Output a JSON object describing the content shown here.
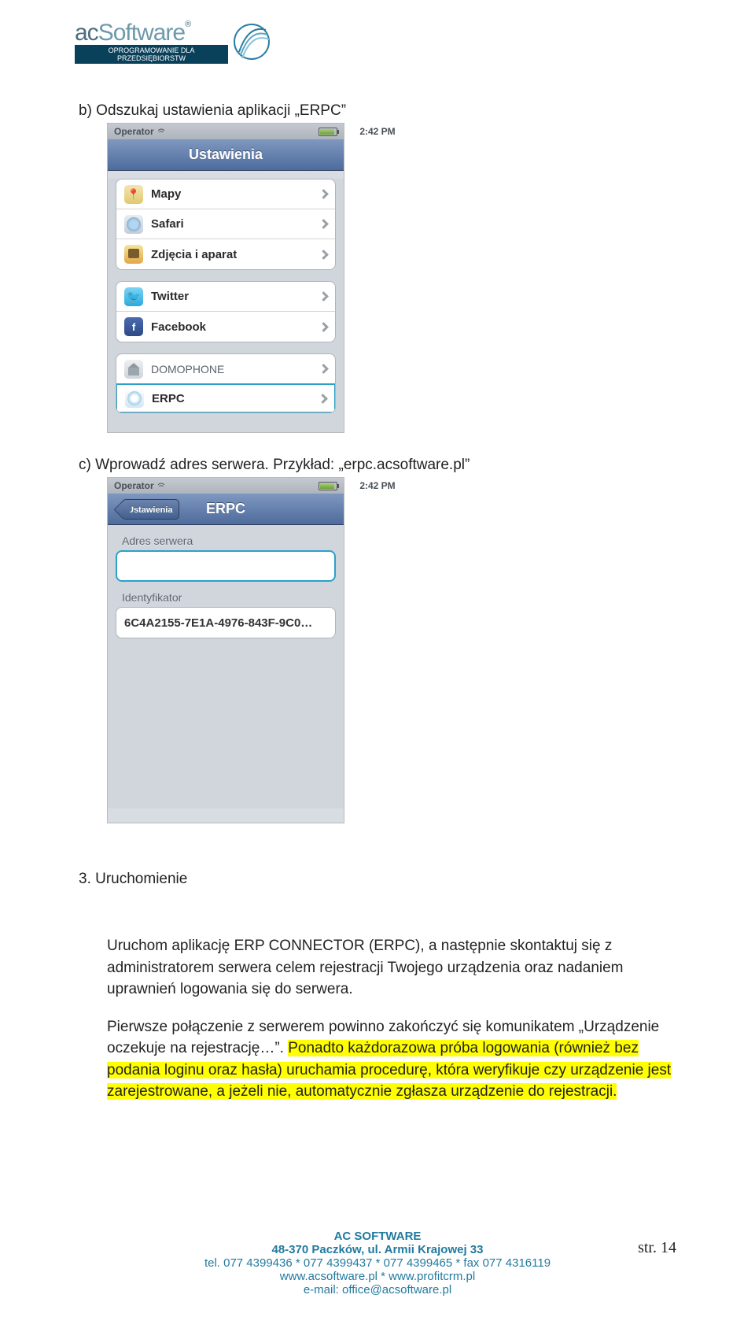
{
  "logo": {
    "name1": "ac",
    "name2": "Software",
    "reg": "®",
    "tagline": "OPROGRAMOWANIE DLA PRZEDSIĘBIORSTW"
  },
  "content": {
    "line_b": "b)  Odszukaj ustawienia aplikacji „ERPC”",
    "line_c": "c)  Wprowadź adres serwera. Przykład: „erpc.acsoftware.pl”",
    "sec3_title": "3. Uruchomienie",
    "sec3_p1": "Uruchom aplikację ERP CONNECTOR (ERPC), a następnie skontaktuj się z administratorem serwera celem rejestracji Twojego urządzenia oraz nadaniem uprawnień logowania się do serwera.",
    "sec3_p2a": "Pierwsze połączenie z serwerem powinno zakończyć się komunikatem „Urządzenie oczekuje na rejestrację…”. ",
    "sec3_p2b": "Ponadto każdorazowa próba logowania (również bez podania loginu oraz hasła) uruchamia procedurę, która weryfikuje czy urządzenie jest zarejestrowane, a jeżeli nie, automatycznie zgłasza urządzenie do rejestracji."
  },
  "phone1": {
    "operator": "Operator",
    "time": "2:42 PM",
    "title": "Ustawienia",
    "group1": [
      "Mapy",
      "Safari",
      "Zdjęcia i aparat"
    ],
    "group2": [
      "Twitter",
      "Facebook"
    ],
    "group3": [
      "DOMOPHONE",
      "ERPC"
    ]
  },
  "phone2": {
    "operator": "Operator",
    "time": "2:42 PM",
    "back": "Ustawienia",
    "title": "ERPC",
    "label1": "Adres serwera",
    "value1": "",
    "label2": "Identyfikator",
    "value2": "6C4A2155-7E1A-4976-843F-9C0…"
  },
  "footer": {
    "l1": "AC SOFTWARE",
    "l2": "48-370 Paczków, ul. Armii Krajowej 33",
    "l3": "tel. 077 4399436 * 077 4399437 * 077 4399465 * fax 077 4316119",
    "l4": "www.acsoftware.pl * www.profitcrm.pl",
    "l5": "e-mail: office@acsoftware.pl"
  },
  "page": "str. 14"
}
